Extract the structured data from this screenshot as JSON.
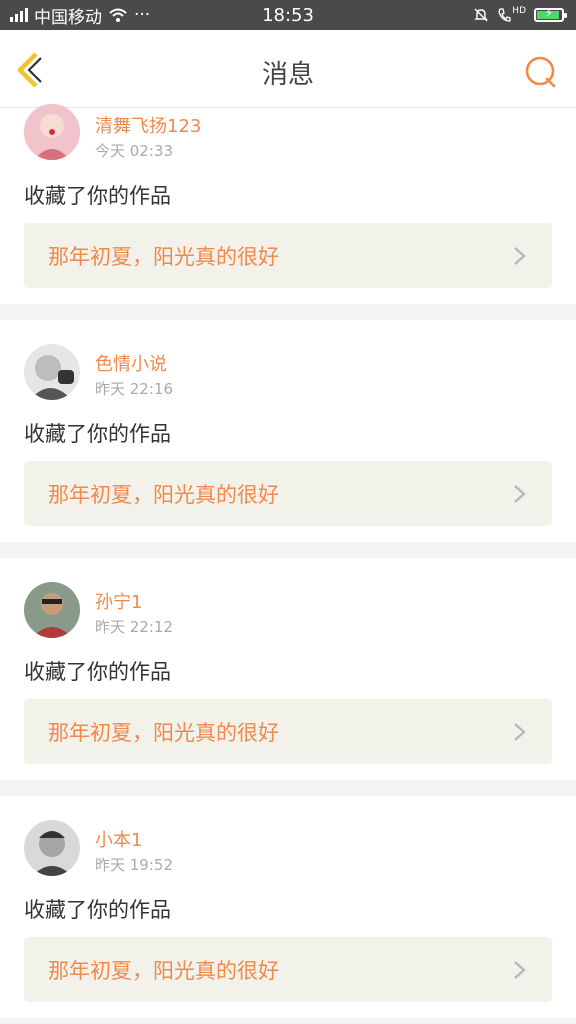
{
  "status_bar": {
    "carrier": "中国移动",
    "time": "18:53",
    "dots": "···",
    "net_badge": "HD",
    "colors": {
      "bar": "#4a4a4a",
      "battery": "#4cd964"
    }
  },
  "header": {
    "title": "消息",
    "colors": {
      "accent": "#f0c330",
      "search": "#f08a4b"
    }
  },
  "messages": [
    {
      "username": "清舞飞扬123",
      "time": "今天 02:33",
      "action": "收藏了你的作品",
      "work_title": "那年初夏，阳光真的很好",
      "avatar_color": "#e7a6b3"
    },
    {
      "username": "色情小说",
      "time": "昨天 22:16",
      "action": "收藏了你的作品",
      "work_title": "那年初夏，阳光真的很好",
      "avatar_color": "#bdbdbd"
    },
    {
      "username": "孙宁1",
      "time": "昨天 22:12",
      "action": "收藏了你的作品",
      "work_title": "那年初夏，阳光真的很好",
      "avatar_color": "#6c6c6c"
    },
    {
      "username": "小本1",
      "time": "昨天 19:52",
      "action": "收藏了你的作品",
      "work_title": "那年初夏，阳光真的很好",
      "avatar_color": "#9e9e9e"
    }
  ]
}
